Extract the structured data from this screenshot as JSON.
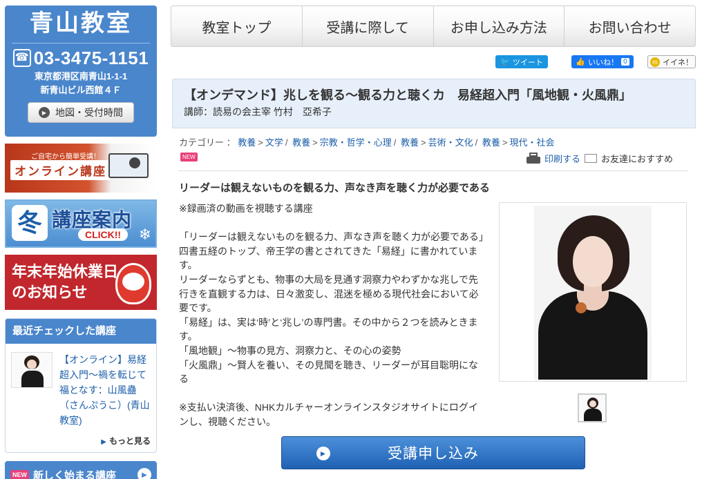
{
  "school": {
    "name": "青山教室",
    "phone": "03-3475-1151",
    "address_line1": "東京都港区南青山1-1-1",
    "address_line2": "新青山ビル西館４Ｆ",
    "map_button": "地図・受付時間"
  },
  "banners": {
    "online_small": "ご自宅から簡単受講！",
    "online_label": "オンライン講座",
    "winter_char": "冬",
    "winter_title": "講座案内",
    "winter_click": "CLICK!!",
    "holiday_line1": "年末年始休業日",
    "holiday_line2": "のお知らせ"
  },
  "recent": {
    "title": "最近チェックした講座",
    "item_text": "【オンライン】易経超入門〜禍を転じて福となす：山風蠱（さんぷうこ）(青山教室)",
    "more": "もっと見る"
  },
  "new_courses": {
    "badge": "NEW",
    "title": "新しく始まる講座"
  },
  "nav": {
    "items": [
      "教室トップ",
      "受講に際して",
      "お申し込み方法",
      "お問い合わせ"
    ]
  },
  "social": {
    "tweet": "ツイート",
    "like": "いいね！",
    "like_count": "0",
    "iine": "イイネ！"
  },
  "course": {
    "title": "【オンデマンド】兆しを観る～観る力と聴くカ　易経超入門「風地観・火風鼎」",
    "instructor": "講師：読易の会主宰 竹村　亞希子",
    "category_label": "カテゴリー ：",
    "categories": [
      [
        "教養",
        "文学"
      ],
      [
        "教養",
        "宗教・哲学・心理"
      ],
      [
        "教養",
        "芸術・文化"
      ],
      [
        "教養",
        "現代・社会"
      ]
    ],
    "new_badge": "NEW",
    "print": "印刷する",
    "recommend": "お友達におすすめ",
    "lead": "リーダーは観えないものを観る力、声なき声を聴く力が必要である",
    "description": [
      "※録画済の動画を視聴する講座",
      "",
      "「リーダーは観えないものを観る力、声なき声を聴く力が必要である」",
      "四書五経のトップ、帝王学の書とされてきた「易経」に書かれています。",
      "リーダーならずとも、物事の大局を見通す洞察力やわずかな兆しで先行きを直観する力は、日々激変し、混迷を極める現代社会において必要です。",
      "「易経」は、実は‘時’と‘兆し’の専門書。その中から２つを読みときます。",
      "「風地観」～物事の見方、洞察力と、その心の姿勢",
      "「火風鼎」～賢人を養い、その見聞を聴き、リーダーが耳目聡明になる",
      "",
      "※支払い決済後、NHKカルチャーオンラインスタジオサイトにログインし、視聴ください。"
    ],
    "apply": "受講申し込み"
  },
  "icons": {
    "phone": "phone-icon",
    "play": "play-icon",
    "printer": "printer-icon",
    "mail": "mail-icon"
  },
  "colors": {
    "brand_blue": "#4a86cc",
    "header_bg": "#e7f0fa",
    "link": "#1e5faa",
    "new_pink": "#e8417a"
  }
}
